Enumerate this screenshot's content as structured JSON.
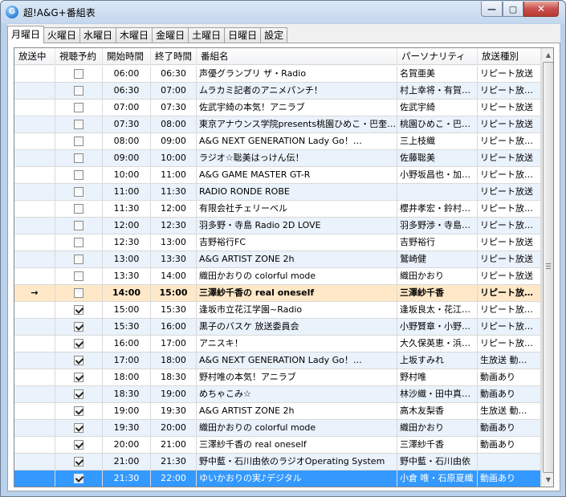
{
  "window": {
    "title": "超!A&G+番組表",
    "app_icon_glyph": "G",
    "controls": {
      "minimize_glyph": "—",
      "maximize_glyph": "▢",
      "close_glyph": "✕"
    }
  },
  "tabs": [
    {
      "label": "月曜日",
      "active": true
    },
    {
      "label": "火曜日",
      "active": false
    },
    {
      "label": "水曜日",
      "active": false
    },
    {
      "label": "木曜日",
      "active": false
    },
    {
      "label": "金曜日",
      "active": false
    },
    {
      "label": "土曜日",
      "active": false
    },
    {
      "label": "日曜日",
      "active": false
    },
    {
      "label": "設定",
      "active": false
    }
  ],
  "table": {
    "columns": [
      "放送中",
      "視聴予約",
      "開始時間",
      "終了時間",
      "番組名",
      "パーソナリティ",
      "放送種別"
    ],
    "rows": [
      {
        "onair": "",
        "reserved": false,
        "start": "06:00",
        "end": "06:30",
        "title": "声優グランプリ ザ・Radio",
        "personality": "名賀亜美",
        "kind": "リピート放送"
      },
      {
        "onair": "",
        "reserved": false,
        "start": "06:30",
        "end": "07:00",
        "title": "ムラカミ記者のアニメパンチ！",
        "personality": "村上幸将・有賀…",
        "kind": "リピート放送 …"
      },
      {
        "onair": "",
        "reserved": false,
        "start": "07:00",
        "end": "07:30",
        "title": "佐武宇綺の本気！アニラブ",
        "personality": "佐武宇綺",
        "kind": "リピート放送"
      },
      {
        "onair": "",
        "reserved": false,
        "start": "07:30",
        "end": "08:00",
        "title": "東京アナウンス学院presents桃園ひめこ・巴奎依…",
        "personality": "桃園ひめこ・巴奎依",
        "kind": "リピート放送"
      },
      {
        "onair": "",
        "reserved": false,
        "start": "08:00",
        "end": "09:00",
        "title": "A&G NEXT GENERATION Lady Go！…",
        "personality": "三上枝織",
        "kind": "リピート放送 …"
      },
      {
        "onair": "",
        "reserved": false,
        "start": "09:00",
        "end": "10:00",
        "title": "ラジオ☆聡美はっけん伝！",
        "personality": "佐藤聡美",
        "kind": "リピート放送"
      },
      {
        "onair": "",
        "reserved": false,
        "start": "10:00",
        "end": "11:00",
        "title": "A&G GAME MASTER GT-R",
        "personality": "小野坂昌也・加…",
        "kind": "リピート放送 …"
      },
      {
        "onair": "",
        "reserved": false,
        "start": "11:00",
        "end": "11:30",
        "title": "RADIO RONDE ROBE",
        "personality": "",
        "kind": "リピート放送"
      },
      {
        "onair": "",
        "reserved": false,
        "start": "11:30",
        "end": "12:00",
        "title": "有限会社チェリーベル",
        "personality": "櫻井孝宏・鈴村…",
        "kind": "リピート放送 …"
      },
      {
        "onair": "",
        "reserved": false,
        "start": "12:00",
        "end": "12:30",
        "title": "羽多野・寺島 Radio 2D LOVE",
        "personality": "羽多野渉・寺島…",
        "kind": "リピート放送 …"
      },
      {
        "onair": "",
        "reserved": false,
        "start": "12:30",
        "end": "13:00",
        "title": "吉野裕行FC",
        "personality": "吉野裕行",
        "kind": "リピート放送"
      },
      {
        "onair": "",
        "reserved": false,
        "start": "13:00",
        "end": "13:30",
        "title": "A&G ARTIST ZONE 2h",
        "personality": "鷲崎健",
        "kind": "リピート放送"
      },
      {
        "onair": "",
        "reserved": false,
        "start": "13:30",
        "end": "14:00",
        "title": "織田かおりの colorful mode",
        "personality": "織田かおり",
        "kind": "リピート放送"
      },
      {
        "onair": "→",
        "reserved": false,
        "start": "14:00",
        "end": "15:00",
        "title": "三澤紗千香の real oneself",
        "personality": "三澤紗千香",
        "kind": "リピート放…"
      },
      {
        "onair": "",
        "reserved": true,
        "start": "15:00",
        "end": "15:30",
        "title": "逢坂市立花江学園~Radio",
        "personality": "逢坂良太・花江…",
        "kind": "リピート放送 …"
      },
      {
        "onair": "",
        "reserved": true,
        "start": "15:30",
        "end": "16:00",
        "title": "黒子のバスケ 放送委員会",
        "personality": "小野賢章・小野…",
        "kind": "リピート放送 …"
      },
      {
        "onair": "",
        "reserved": true,
        "start": "16:00",
        "end": "17:00",
        "title": "アニスキ！",
        "personality": "大久保英恵・浜…",
        "kind": "リピート放送 …"
      },
      {
        "onair": "",
        "reserved": true,
        "start": "17:00",
        "end": "18:00",
        "title": "A&G NEXT GENERATION Lady Go！…",
        "personality": "上坂すみれ",
        "kind": "生放送 動…"
      },
      {
        "onair": "",
        "reserved": true,
        "start": "18:00",
        "end": "18:30",
        "title": "野村唯の本気！アニラブ",
        "personality": "野村唯",
        "kind": "動画あり"
      },
      {
        "onair": "",
        "reserved": true,
        "start": "18:30",
        "end": "19:00",
        "title": "めちゃこみ☆",
        "personality": "林沙織・田中真…",
        "kind": "動画あり"
      },
      {
        "onair": "",
        "reserved": true,
        "start": "19:00",
        "end": "19:30",
        "title": "A&G ARTIST ZONE 2h",
        "personality": "高木友梨香",
        "kind": "生放送 動…"
      },
      {
        "onair": "",
        "reserved": true,
        "start": "19:30",
        "end": "20:00",
        "title": "織田かおりの colorful mode",
        "personality": "織田かおり",
        "kind": "動画あり"
      },
      {
        "onair": "",
        "reserved": true,
        "start": "20:00",
        "end": "21:00",
        "title": "三澤紗千香の real oneself",
        "personality": "三澤紗千香",
        "kind": "動画あり"
      },
      {
        "onair": "",
        "reserved": true,
        "start": "21:00",
        "end": "21:30",
        "title": "野中藍・石川由依のラジオOperating System",
        "personality": "野中藍・石川由依",
        "kind": ""
      },
      {
        "onair": "",
        "reserved": true,
        "start": "21:30",
        "end": "22:00",
        "title": "ゆいかおりの実♪デジタル",
        "personality": "小倉 唯・石原夏織",
        "kind": "動画あり"
      }
    ],
    "onair_row_index": 13,
    "selected_row_index": 24
  },
  "scrollbar": {
    "up_glyph": "▲",
    "down_glyph": "▼"
  }
}
